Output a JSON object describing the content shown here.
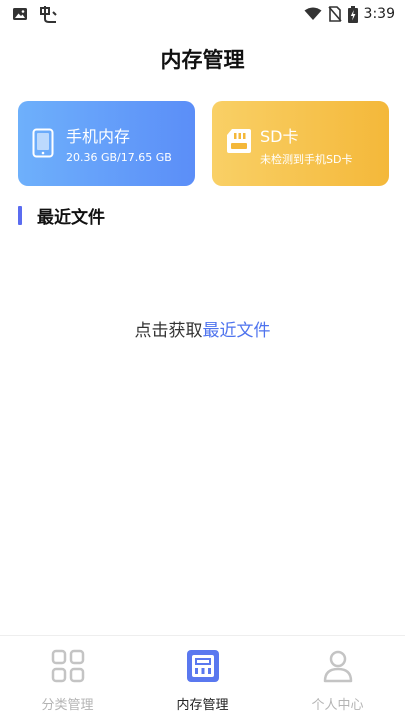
{
  "status_bar": {
    "time": "3:39",
    "left_icons": [
      "image-icon",
      "bug-icon"
    ],
    "right_icons": [
      "wifi-icon",
      "no-sim-icon",
      "battery-charging-icon"
    ]
  },
  "header": {
    "title": "内存管理"
  },
  "storage_cards": {
    "phone": {
      "title": "手机内存",
      "usage": "20.36 GB/17.65 GB",
      "icon": "phone-icon",
      "colors": [
        "#6eb0fb",
        "#5b8ef8"
      ]
    },
    "sd": {
      "title": "SD卡",
      "status": "未检测到手机SD卡",
      "icon": "sd-card-icon",
      "colors": [
        "#f9d066",
        "#f4b83a"
      ]
    }
  },
  "recent_section": {
    "title": "最近文件",
    "accent": "#5b6cf0"
  },
  "empty_state": {
    "prefix": "点击获取",
    "link": "最近文件",
    "link_color": "#4e73ee"
  },
  "bottom_nav": {
    "items": [
      {
        "label": "分类管理",
        "icon": "grid-icon",
        "active": false
      },
      {
        "label": "内存管理",
        "icon": "memory-chip-icon",
        "active": true
      },
      {
        "label": "个人中心",
        "icon": "person-icon",
        "active": false
      }
    ],
    "active_color": "#4e73ee",
    "inactive_color": "#c4c4c4"
  }
}
